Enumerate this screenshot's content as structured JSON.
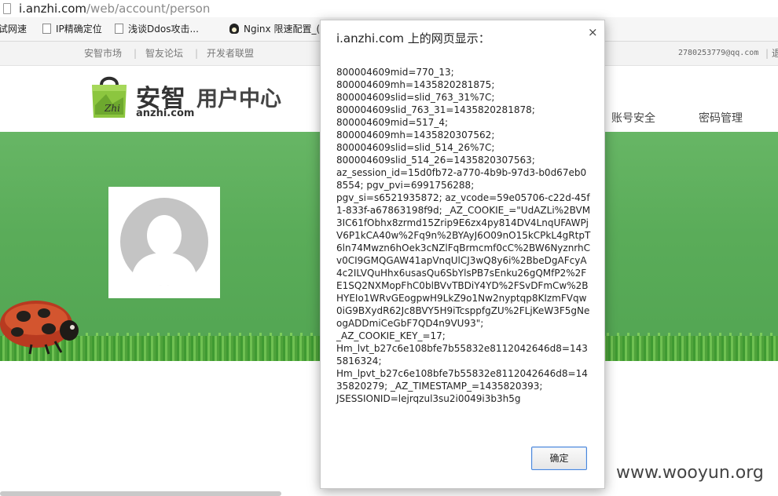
{
  "browser": {
    "url_host": "i.anzhi.com",
    "url_path": "/web/account/person",
    "bookmarks": [
      {
        "label": "试网速",
        "icon": "none"
      },
      {
        "label": "IP精确定位",
        "icon": "page-icon"
      },
      {
        "label": "浅谈Ddos攻击...",
        "icon": "page-icon"
      },
      {
        "label": "Nginx 限速配置_(",
        "icon": "tux-icon"
      }
    ]
  },
  "topnav": {
    "links": [
      "安智市场",
      "智友论坛",
      "开发者联盟"
    ],
    "separator": "|",
    "email": "2780253779@qq.com",
    "cut_sep": "|",
    "cut_text": "退"
  },
  "header": {
    "brand": "安智",
    "domain": "anzhi.com",
    "subtitle": "用户中心",
    "nav": [
      "账号安全",
      "密码管理"
    ]
  },
  "dialog": {
    "title": "i.anzhi.com 上的网页显示：",
    "close": "×",
    "message": "800004609mid=770_13;\n800004609mh=1435820281875;\n800004609slid=slid_763_31%7C;\n800004609slid_763_31=1435820281878;\n800004609mid=517_4;\n800004609mh=1435820307562;\n800004609slid=slid_514_26%7C;\n800004609slid_514_26=1435820307563;\naz_session_id=15d0fb72-a770-4b9b-97d3-b0d67eb08554; pgv_pvi=6991756288;\npgv_si=s6521935872; az_vcode=59e05706-c22d-45f1-833f-a67863198f9d; _AZ_COOKIE_=\"UdAZLi%2BVM3IC61fObhx8zrmd15Zrip9E6zx4py814DV4LnqUFAWPjV6P1kCA40w%2Fq9n%2BYAyJ6O09nO15kCPkL4gRtpT6ln74Mwzn6hOek3cNZlFqBrmcmf0cC%2BW6NyznrhCv0CI9GMQGAW41apVnqUlCJ3wQ8y6i%2BbeDgAFcyA4c2ILVQuHhx6usasQu6SbYlsPB7sEnku26gQMfP2%2FE1SQ2NXMopFhC0blBVvTBDiY4YD%2FSvDFmCw%2BHYEIo1WRvGEogpwH9LkZ9o1Nw2nyptqp8KIzmFVqw0iG9BXydR62Jc8BVY5H9iTcsppfgZU%2FLjKeW3F5gNeogADDmiCeGbF7QD4n9VU93\";\n_AZ_COOKIE_KEY_=17;\nHm_lvt_b27c6e108bfe7b55832e8112042646d8=1435816324;\nHm_lpvt_b27c6e108bfe7b55832e8112042646d8=1435820279; _AZ_TIMESTAMP_=1435820393;\nJSESSIONID=lejrqzul3su2i0049i3b3h5g",
    "ok_label": "确定"
  },
  "watermark": "www.wooyun.org",
  "colors": {
    "banner_green": "#5aac59",
    "grass_green": "#4fa33b",
    "button_border": "#4a86d9"
  }
}
